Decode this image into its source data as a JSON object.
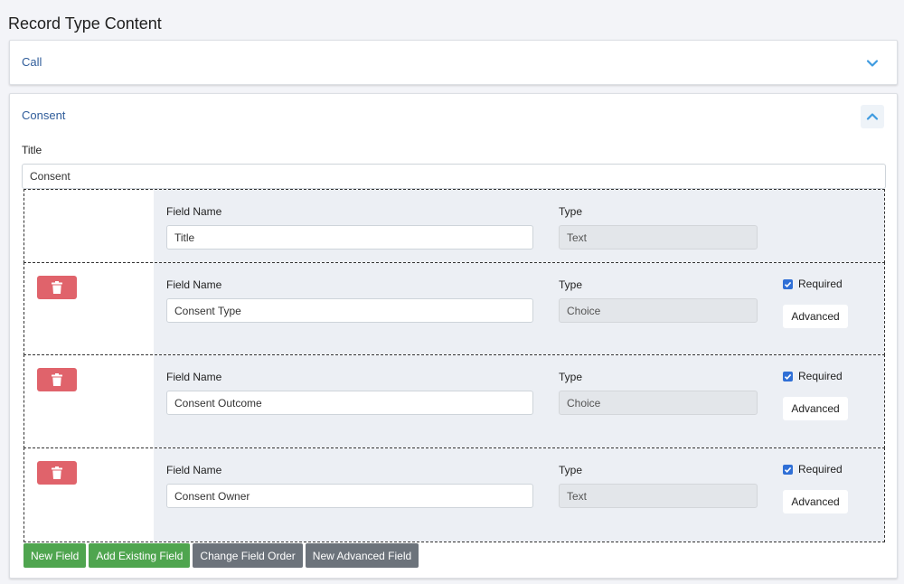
{
  "page": {
    "title": "Record Type Content"
  },
  "sections": {
    "call": {
      "title": "Call",
      "expanded": false
    },
    "consent": {
      "title": "Consent",
      "expanded": true,
      "title_label": "Title",
      "title_value": "Consent"
    }
  },
  "fields": [
    {
      "field_name_label": "Field Name",
      "field_name": "Title",
      "type_label": "Type",
      "type": "Text",
      "deletable": false
    },
    {
      "field_name_label": "Field Name",
      "field_name": "Consent Type",
      "type_label": "Type",
      "type": "Choice",
      "deletable": true,
      "required_label": "Required",
      "required": true,
      "advanced_label": "Advanced"
    },
    {
      "field_name_label": "Field Name",
      "field_name": "Consent Outcome",
      "type_label": "Type",
      "type": "Choice",
      "deletable": true,
      "required_label": "Required",
      "required": true,
      "advanced_label": "Advanced"
    },
    {
      "field_name_label": "Field Name",
      "field_name": "Consent Owner",
      "type_label": "Type",
      "type": "Text",
      "deletable": true,
      "required_label": "Required",
      "required": true,
      "advanced_label": "Advanced"
    }
  ],
  "actions": {
    "new_field": "New Field",
    "add_existing_field": "Add Existing Field",
    "change_field_order": "Change Field Order",
    "new_advanced_field": "New Advanced Field"
  },
  "colors": {
    "link_blue": "#2f5c9a",
    "danger": "#e0636b",
    "success": "#4fa54f",
    "secondary": "#6c737b",
    "chevron": "#3f9be0"
  },
  "icons": {
    "collapse_expand": "chevron-down-icon",
    "collapse": "chevron-up-icon",
    "delete": "trash-icon",
    "check": "check-icon"
  }
}
